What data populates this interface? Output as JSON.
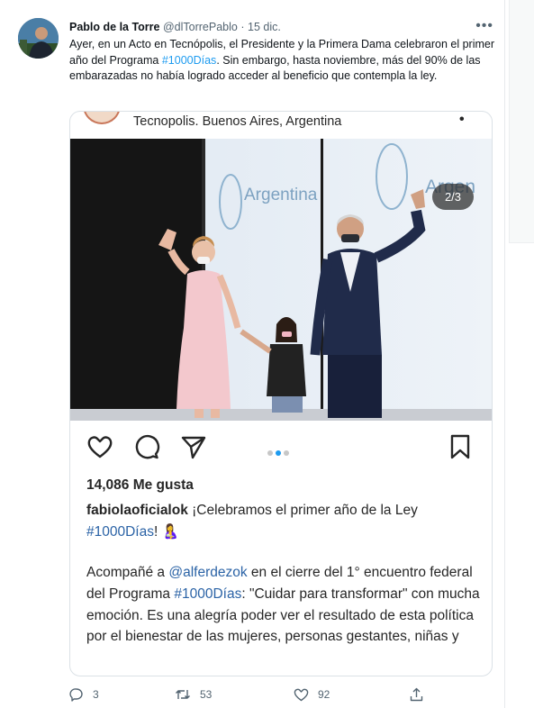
{
  "tweet": {
    "author_name": "Pablo de la Torre",
    "author_handle": "@dlTorrePablo",
    "separator": "·",
    "date": "15 dic.",
    "more_label": "•••",
    "text_part1": "Ayer, en un Acto en Tecnópolis, el Presidente y la Primera Dama celebraron el primer año del Programa ",
    "hashtag": "#1000Días",
    "text_part2": ". Sin embargo, hasta noviembre, más del 90% de las embarazadas no había logrado acceder al beneficio que contempla la ley."
  },
  "embed": {
    "location": "Tecnopolis. Buenos Aires, Argentina",
    "location_menu": "•",
    "photo_counter": "2/3",
    "backdrop_text_left": "Argentina",
    "backdrop_text_right": "Argen",
    "likes": "14,086 Me gusta",
    "caption_user": "fabiolaoficialok",
    "caption_text": " ¡Celebramos el primer año de la Ley ",
    "caption_hashtag": "#1000Días",
    "caption_end": "! 🤱",
    "body_part1": "Acompañé a ",
    "body_mention": "@alferdezok",
    "body_part2": " en el cierre del 1° encuentro federal del Programa ",
    "body_hashtag": "#1000Días",
    "body_part3": ": \"Cuidar para transformar\" con mucha emoción. Es una alegría poder ver el resultado de esta política por el bienestar de las mujeres, personas gestantes, niñas y"
  },
  "footer": {
    "replies": "3",
    "retweets": "53",
    "likes": "92"
  },
  "colors": {
    "accent": "#1d9bf0",
    "text_secondary": "#536471",
    "ig_link": "#2b63a6"
  },
  "icons": [
    "ellipsis-icon",
    "heart-icon",
    "comment-icon",
    "send-icon",
    "bookmark-icon",
    "reply-icon",
    "retweet-icon",
    "like-icon",
    "share-icon"
  ]
}
